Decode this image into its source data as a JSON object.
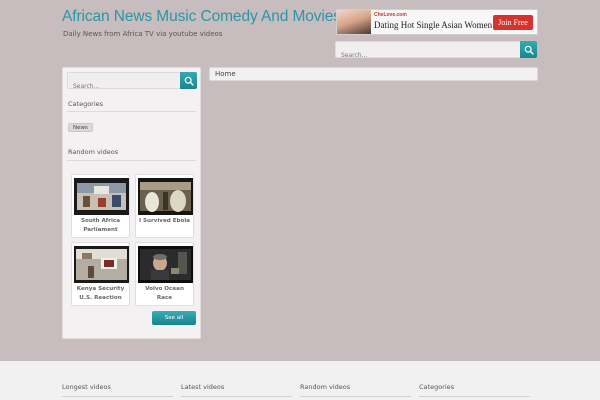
{
  "header": {
    "site_title": "African News Music Comedy And Movies",
    "tagline": "Daily News from Africa TV via youtube videos"
  },
  "ad": {
    "logo": "CheLove.com",
    "text": "Dating Hot Single Asian Women",
    "button": "Join Free"
  },
  "header_search": {
    "placeholder": "Search..."
  },
  "breadcrumb": {
    "home": "Home"
  },
  "sidebar": {
    "search_placeholder": "Search...",
    "categories_heading": "Categories",
    "category_tags": [
      "News"
    ],
    "random_heading": "Random videos",
    "videos": [
      {
        "title": "South Africa Parliament",
        "thumb_icon": "parliament-thumbnail"
      },
      {
        "title": "I Survived Ebola",
        "thumb_icon": "ebola-thumbnail"
      },
      {
        "title": "Kenya Security U.S. Reaction",
        "thumb_icon": "kenya-security-thumbnail"
      },
      {
        "title": "Volvo Ocean Race",
        "thumb_icon": "volvo-ocean-race-thumbnail"
      }
    ],
    "see_all": "See all"
  },
  "footer": {
    "columns": [
      "Longest videos",
      "Latest videos",
      "Random videos",
      "Categories"
    ]
  },
  "colors": {
    "background": "#c7bcbe",
    "accent": "#2a97a3",
    "ad_button": "#d6322e"
  }
}
